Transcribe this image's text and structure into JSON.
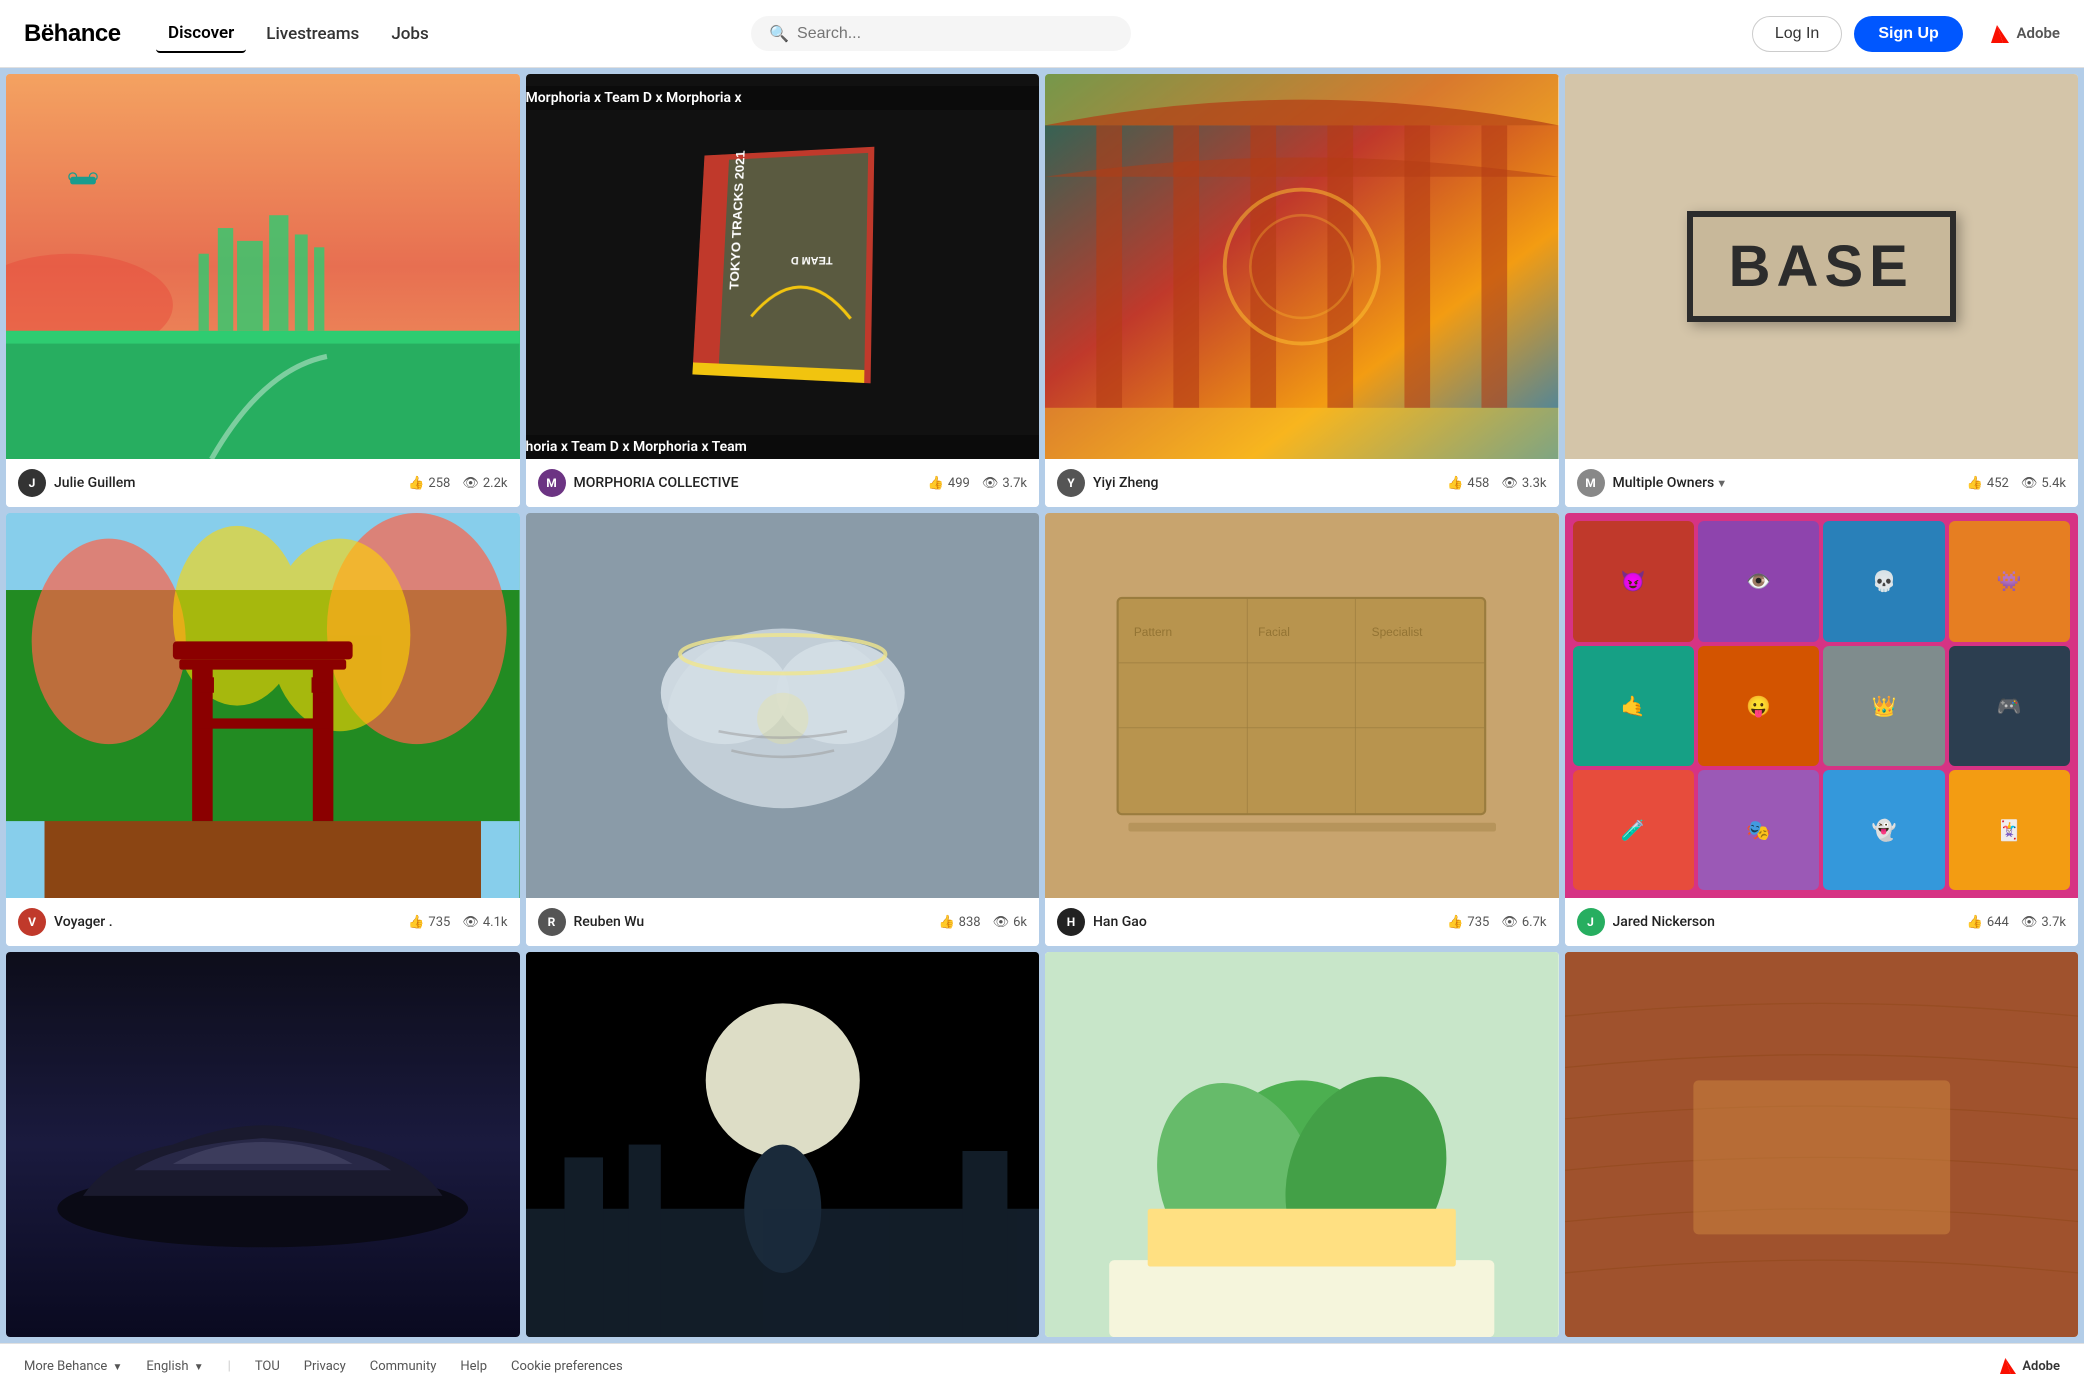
{
  "header": {
    "logo": "Bëhance",
    "nav": [
      {
        "label": "Discover",
        "active": true
      },
      {
        "label": "Livestreams",
        "active": false
      },
      {
        "label": "Jobs",
        "active": false
      }
    ],
    "search_placeholder": "Search...",
    "login_label": "Log In",
    "signup_label": "Sign Up",
    "adobe_label": "Adobe"
  },
  "cards": [
    {
      "id": 1,
      "author": "Julie Guillem",
      "avatar_color": "#333",
      "avatar_initial": "J",
      "likes": "258",
      "views": "2.2k",
      "image_class": "img-1"
    },
    {
      "id": 2,
      "author": "MORPHORIA COLLECTIVE",
      "avatar_color": "#6c3483",
      "avatar_initial": "M",
      "likes": "499",
      "views": "3.7k",
      "image_class": "img-2",
      "marquee_top": "Morphoria x Team D x Morphoria x",
      "marquee_bottom": "horia x Team D x Morphoria x Team"
    },
    {
      "id": 3,
      "author": "Yiyi Zheng",
      "avatar_color": "#555",
      "avatar_initial": "Y",
      "likes": "458",
      "views": "3.3k",
      "image_class": "img-3"
    },
    {
      "id": 4,
      "author": "Multiple Owners",
      "avatar_color": "#888",
      "avatar_initial": "M",
      "likes": "452",
      "views": "5.4k",
      "image_class": "img-4",
      "is_multiple_owners": true
    },
    {
      "id": 5,
      "author": "Voyager .",
      "avatar_color": "#c0392b",
      "avatar_initial": "V",
      "likes": "735",
      "views": "4.1k",
      "image_class": "img-5"
    },
    {
      "id": 6,
      "author": "Reuben Wu",
      "avatar_color": "#555",
      "avatar_initial": "R",
      "likes": "838",
      "views": "6k",
      "image_class": "img-6"
    },
    {
      "id": 7,
      "author": "Han Gao",
      "avatar_color": "#222",
      "avatar_initial": "H",
      "likes": "735",
      "views": "6.7k",
      "image_class": "img-7"
    },
    {
      "id": 8,
      "author": "Jared Nickerson",
      "avatar_color": "#27ae60",
      "avatar_initial": "J",
      "likes": "644",
      "views": "3.7k",
      "image_class": "img-8"
    },
    {
      "id": 9,
      "author": "",
      "avatar_color": "#1a1a2e",
      "avatar_initial": "",
      "likes": "",
      "views": "",
      "image_class": "img-9"
    },
    {
      "id": 10,
      "author": "",
      "avatar_color": "#2c3e50",
      "avatar_initial": "",
      "likes": "",
      "views": "",
      "image_class": "img-10"
    },
    {
      "id": 11,
      "author": "",
      "avatar_color": "#2ecc71",
      "avatar_initial": "",
      "likes": "",
      "views": "",
      "image_class": "img-11"
    },
    {
      "id": 12,
      "author": "",
      "avatar_color": "#8B4513",
      "avatar_initial": "",
      "likes": "",
      "views": "",
      "image_class": "img-12"
    }
  ],
  "footer": {
    "more_behance": "More Behance",
    "language": "English",
    "tou": "TOU",
    "privacy": "Privacy",
    "community": "Community",
    "help": "Help",
    "cookie_prefs": "Cookie preferences",
    "adobe": "Adobe"
  }
}
